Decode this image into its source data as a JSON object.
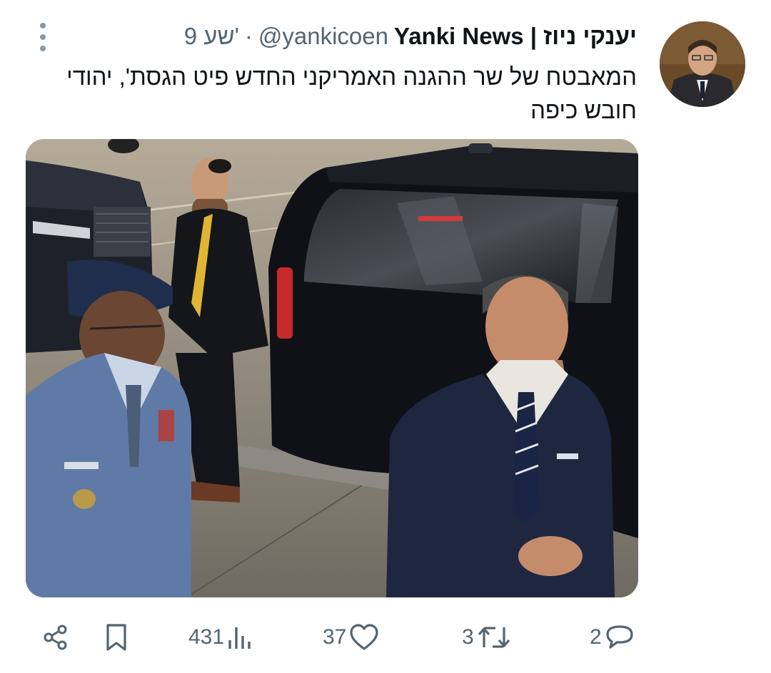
{
  "tweet": {
    "author": {
      "display_name": "Yanki News | יענקי ניוז",
      "handle": "@yankicoen",
      "separator": "·",
      "time": "9 שע'"
    },
    "text": "המאבטח של שר ההגנה האמריקני החדש פיט הגסת', יהודי חובש כיפה",
    "media": {
      "type": "photo"
    }
  },
  "actions": {
    "views": "431",
    "likes": "37",
    "retweets": "3",
    "replies": "2"
  },
  "icons": {
    "share": "share-icon",
    "bookmark": "bookmark-icon",
    "views": "views-icon",
    "like": "heart-icon",
    "retweet": "retweet-icon",
    "reply": "reply-icon",
    "more": "more-vertical-icon"
  },
  "colors": {
    "text_primary": "#0f1419",
    "text_secondary": "#536471",
    "background": "#ffffff"
  }
}
